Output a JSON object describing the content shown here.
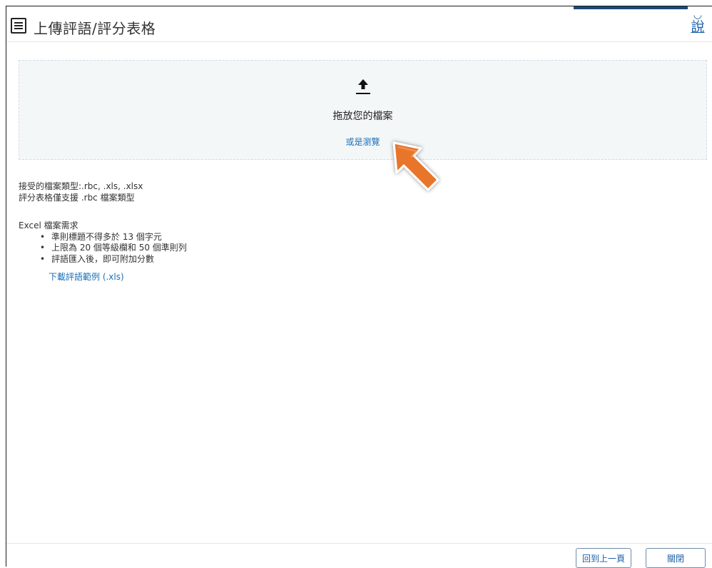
{
  "header": {
    "title": "上傳評語/評分表格",
    "help_label": "說"
  },
  "dropzone": {
    "drop_text": "拖放您的檔案",
    "browse_text": "或是瀏覽",
    "icon": "upload-icon"
  },
  "info": {
    "accepted_types": "接受的檔案類型:.rbc, .xls, .xlsx",
    "rubric_support": "評分表格僅支援 .rbc 檔案類型",
    "excel_heading": "Excel 檔案需求",
    "requirements": [
      "準則標題不得多於 13 個字元",
      "上限為 20 個等級欄和 50 個準則列",
      "評語匯入後，即可附加分數"
    ],
    "download_link": "下載評語範例 (.xls)"
  },
  "footer": {
    "back_label": "回到上一頁",
    "close_label": "關閉"
  },
  "colors": {
    "link": "#1a6fb8",
    "dropzone_bg": "#f4f7f8",
    "accent_bar": "#1f4a73",
    "pointer": "#e8752a"
  }
}
